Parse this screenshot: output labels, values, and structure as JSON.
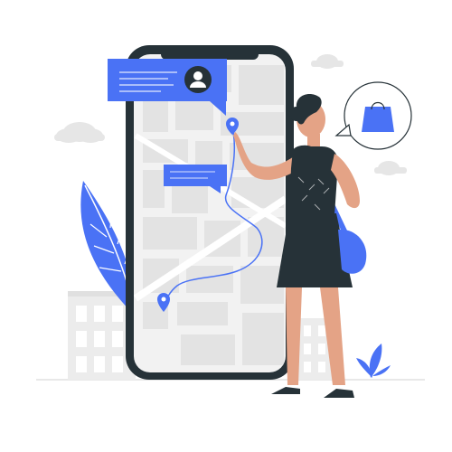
{
  "scene": {
    "kind": "illustration",
    "subject": "person-navigating-with-phone-map",
    "icons": [
      "user-icon",
      "shopping-bag-icon",
      "location-pin-icon",
      "location-pin-icon"
    ],
    "colors": {
      "accent": "#4a72f5",
      "accent_light": "#7b9cf8",
      "phone_frame": "#263238",
      "map_bg": "#f2f2f2",
      "map_road": "#ffffff",
      "map_block": "#e3e3e3",
      "skin": "#e4a386",
      "hair": "#263238",
      "dress": "#263238",
      "cloud": "#e6e6e6",
      "building": "#ececec"
    }
  }
}
